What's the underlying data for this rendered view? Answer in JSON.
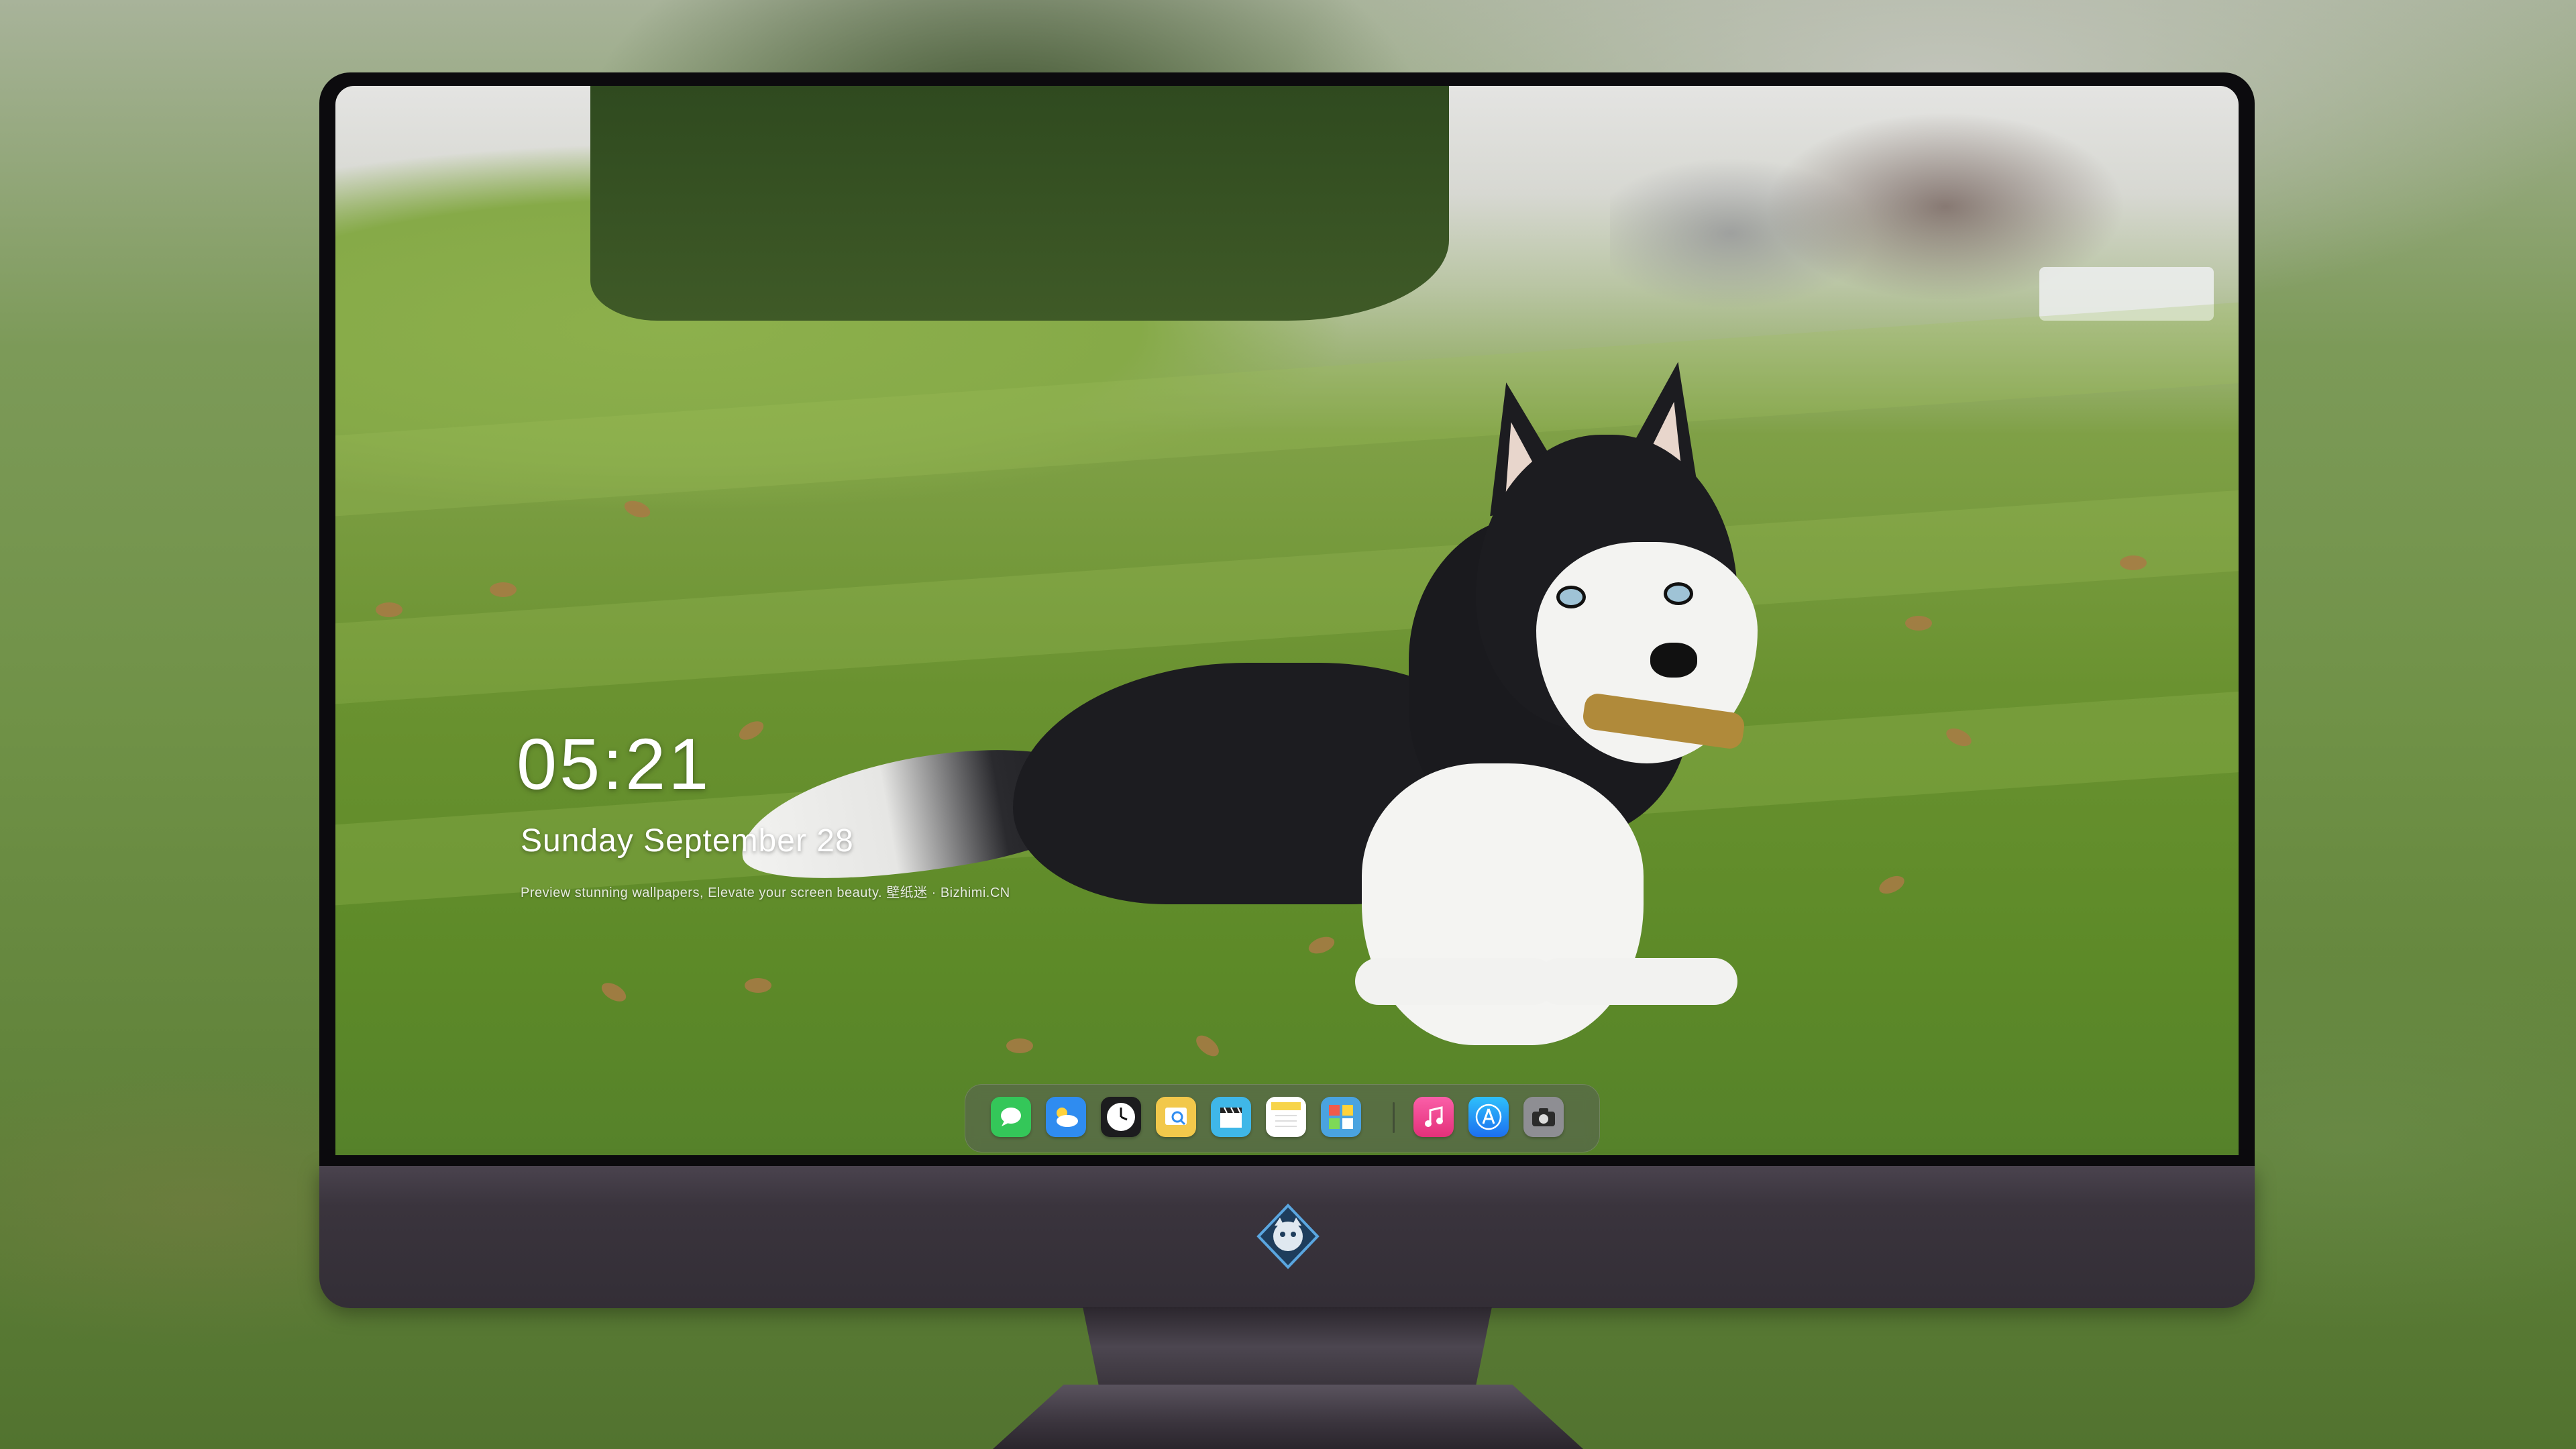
{
  "lockscreen": {
    "time": "05:21",
    "date": "Sunday September 28",
    "tagline": "Preview stunning wallpapers, Elevate your screen beauty. 壁纸迷 · Bizhimi.CN"
  },
  "dock": {
    "apps": [
      {
        "name": "Messages",
        "icon": "message-bubble-icon",
        "color": "#34c759"
      },
      {
        "name": "Weather",
        "icon": "cloud-sun-icon",
        "color": "#2f8cf0"
      },
      {
        "name": "Clock",
        "icon": "clock-icon",
        "color": "#1c1c1e"
      },
      {
        "name": "Preview",
        "icon": "preview-icon",
        "color": "#f2c84b"
      },
      {
        "name": "Clips",
        "icon": "clapperboard-icon",
        "color": "#3fb7e8"
      },
      {
        "name": "Notes",
        "icon": "notes-icon",
        "color": "#f7d44a"
      },
      {
        "name": "Photos Browser",
        "icon": "photos-grid-icon",
        "color": "#4aa3e0"
      },
      {
        "name": "Music",
        "icon": "music-note-icon",
        "color": "#f0478f"
      },
      {
        "name": "App Store",
        "icon": "app-store-icon",
        "color": "#1c8ef9"
      },
      {
        "name": "Camera",
        "icon": "camera-icon",
        "color": "#8e8e93"
      }
    ]
  },
  "colors": {
    "chin": "#3a343d",
    "bezel": "#0c0b0e"
  }
}
